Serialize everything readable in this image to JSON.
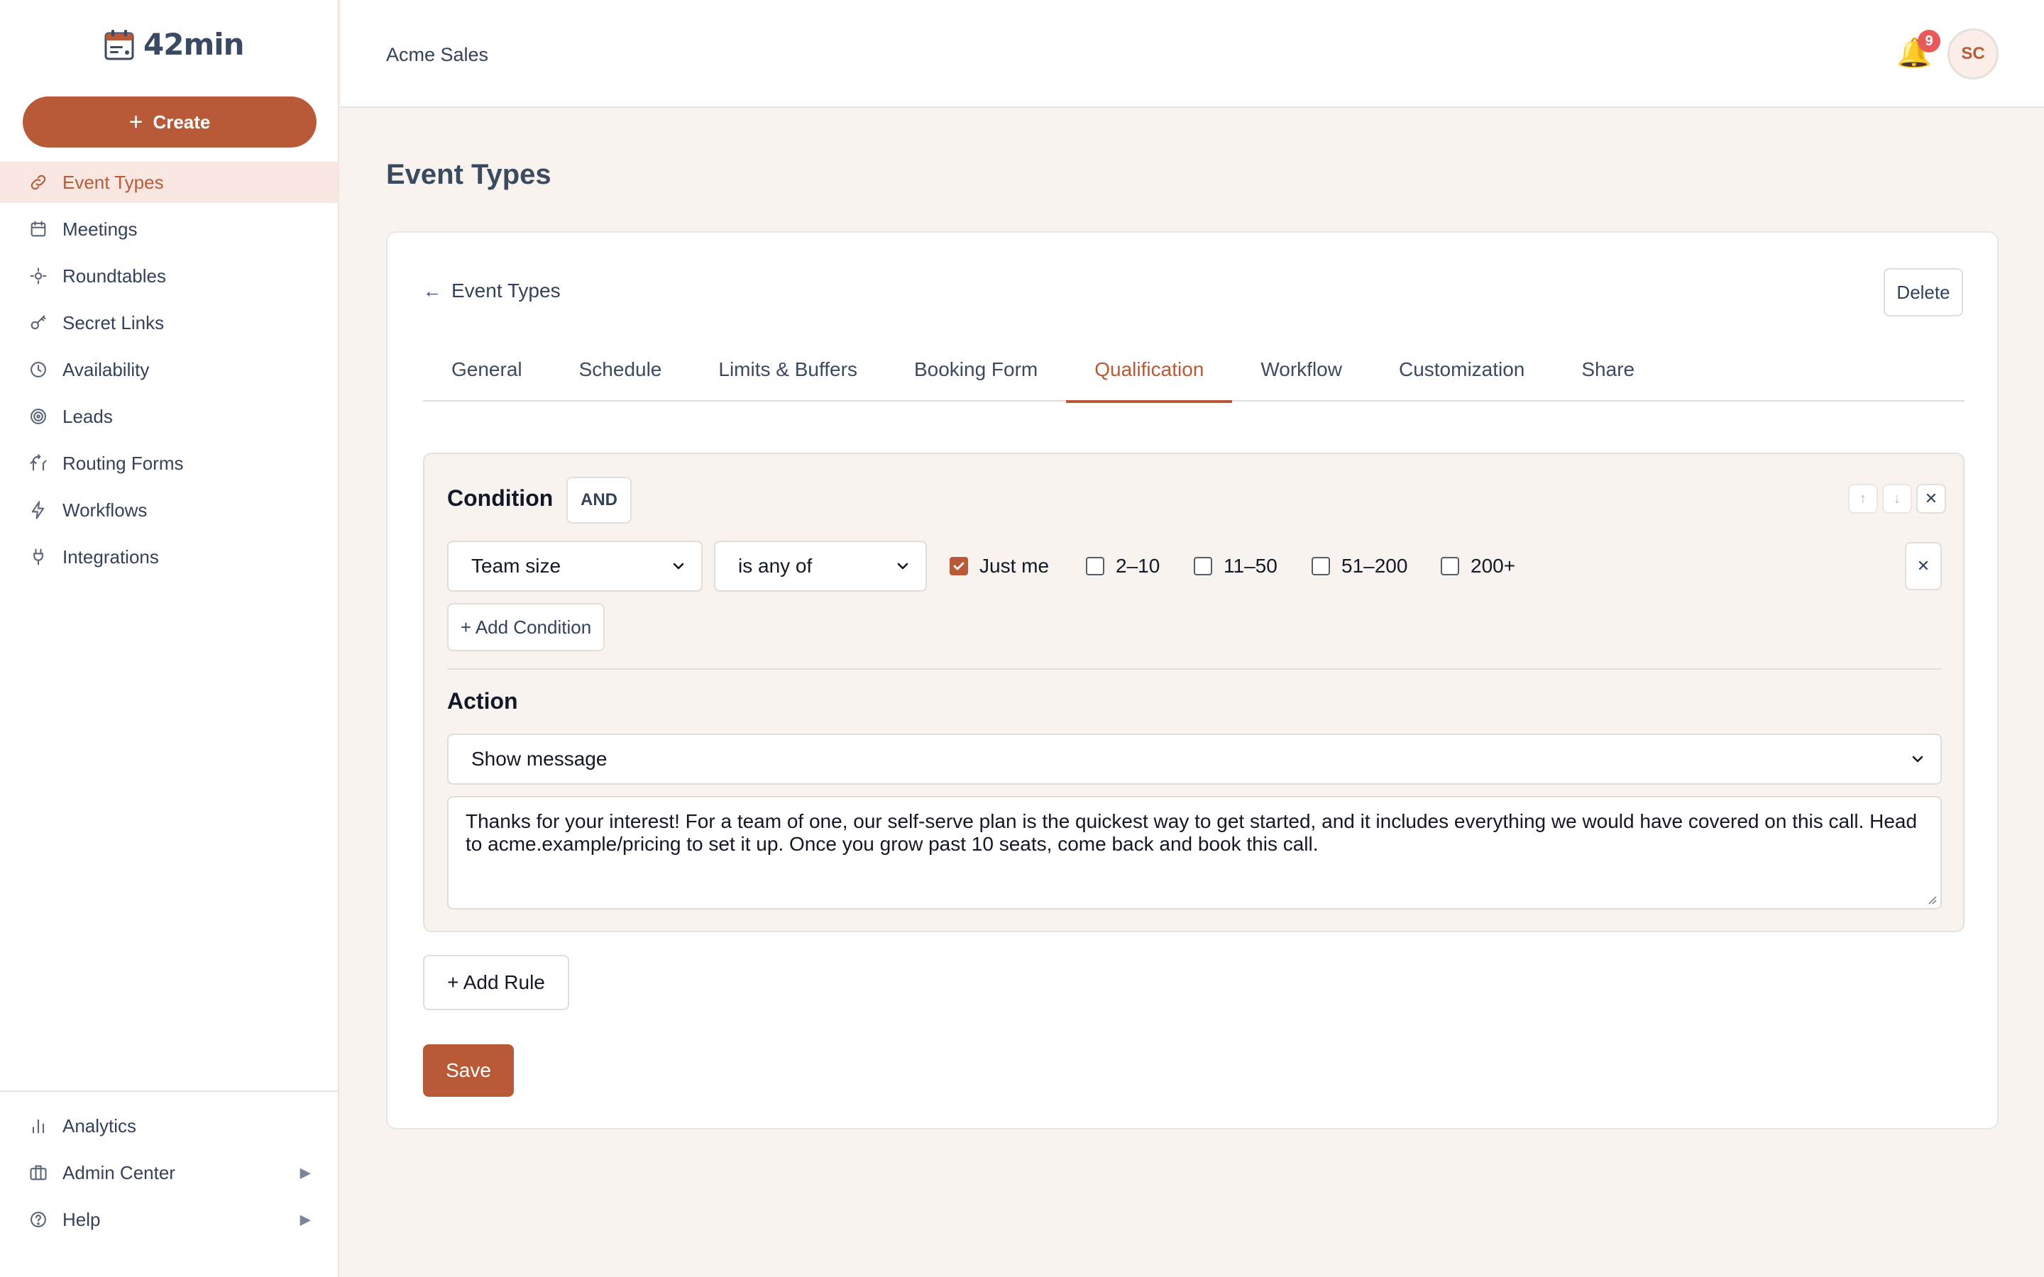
{
  "app": {
    "name": "42min"
  },
  "sidebar": {
    "create_label": "Create",
    "items": [
      {
        "label": "Event Types",
        "icon": "link-icon",
        "active": true
      },
      {
        "label": "Meetings",
        "icon": "calendar-icon"
      },
      {
        "label": "Roundtables",
        "icon": "roundtable-icon"
      },
      {
        "label": "Secret Links",
        "icon": "key-icon"
      },
      {
        "label": "Availability",
        "icon": "clock-icon"
      },
      {
        "label": "Leads",
        "icon": "target-icon"
      },
      {
        "label": "Routing Forms",
        "icon": "route-icon"
      },
      {
        "label": "Workflows",
        "icon": "bolt-icon"
      },
      {
        "label": "Integrations",
        "icon": "plug-icon"
      }
    ],
    "bottom_items": [
      {
        "label": "Analytics",
        "icon": "bar-chart-icon"
      },
      {
        "label": "Admin Center",
        "icon": "briefcase-icon"
      },
      {
        "label": "Help",
        "icon": "help-icon"
      }
    ]
  },
  "topbar": {
    "org_name": "Acme Sales",
    "notification_count": "9",
    "avatar_initials": "SC"
  },
  "page": {
    "title": "Event Types"
  },
  "card": {
    "back_label": "Event Types",
    "delete_label": "Delete",
    "tabs": [
      {
        "label": "General"
      },
      {
        "label": "Schedule"
      },
      {
        "label": "Limits & Buffers"
      },
      {
        "label": "Booking Form"
      },
      {
        "label": "Qualification",
        "active": true
      },
      {
        "label": "Workflow"
      },
      {
        "label": "Customization"
      },
      {
        "label": "Share"
      }
    ]
  },
  "rule": {
    "condition_title": "Condition",
    "operator": "AND",
    "field_value": "Team size",
    "comparator_value": "is any of",
    "options": [
      {
        "label": "Just me",
        "checked": true
      },
      {
        "label": "2–10",
        "checked": false
      },
      {
        "label": "11–50",
        "checked": false
      },
      {
        "label": "51–200",
        "checked": false
      },
      {
        "label": "200+",
        "checked": false
      }
    ],
    "add_condition_label": "+ Add Condition",
    "action_title": "Action",
    "action_value": "Show message",
    "message": "Thanks for your interest! For a team of one, our self-serve plan is the quickest way to get started, and it includes everything we would have covered on this call. Head to acme.example/pricing to set it up. Once you grow past 10 seats, come back and book this call."
  },
  "add_rule_label": "+ Add Rule",
  "save_label": "Save",
  "colors": {
    "accent": "#b85a37",
    "background": "#f8f3ee",
    "text": "#33425a"
  }
}
